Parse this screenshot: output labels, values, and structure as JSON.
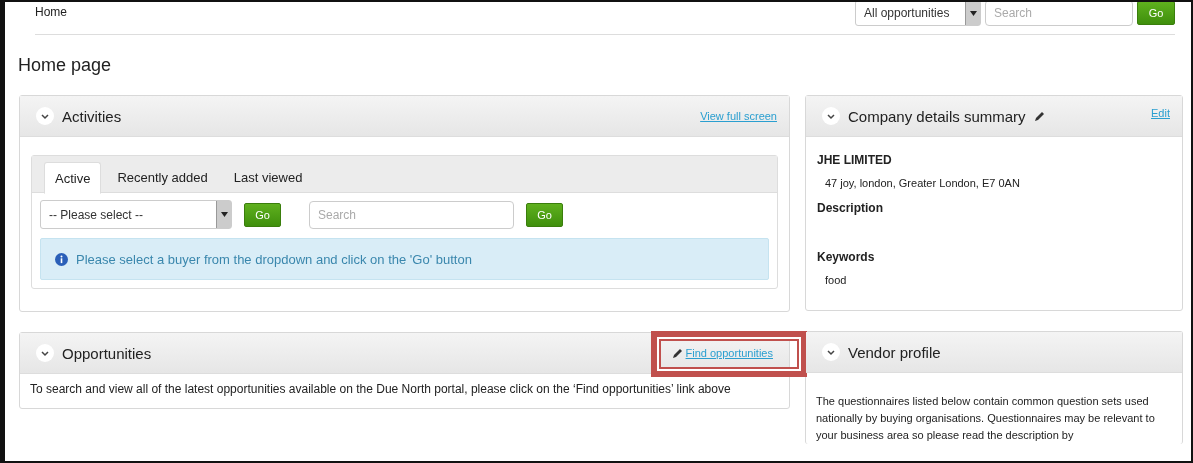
{
  "top_bar": {
    "breadcrumb": "Home",
    "scope_select": {
      "value": "All opportunities"
    },
    "search": {
      "placeholder": "Search"
    },
    "go_button": "Go"
  },
  "page_title": "Home page",
  "activities": {
    "title": "Activities",
    "link": "View full screen",
    "tabs": [
      {
        "label": "Active",
        "selected": true
      },
      {
        "label": "Recently added",
        "selected": false
      },
      {
        "label": "Last viewed",
        "selected": false
      }
    ],
    "buyer_select": {
      "value": "-- Please select --"
    },
    "go_button_1": "Go",
    "search": {
      "placeholder": "Search"
    },
    "go_button_2": "Go",
    "info": "Please select a buyer from the dropdown and click on the 'Go' button"
  },
  "opportunities": {
    "title": "Opportunities",
    "link": "Find opportunities",
    "highlighted": true,
    "text": "To search and view all of the latest opportunities available on the Due North portal, please click on the ‘Find opportunities’ link above"
  },
  "company": {
    "title": "Company details summary",
    "edit": "Edit",
    "name": "JHE LIMITED",
    "address": "47 joy, london, Greater London, E7 0AN",
    "description_label": "Description",
    "keywords_label": "Keywords",
    "keywords": "food"
  },
  "vendor": {
    "title": "Vendor profile",
    "text": "The questionnaires listed below contain common question sets used nationally by buying organisations. Questionnaires may be relevant to your business area so please read the description by"
  }
}
